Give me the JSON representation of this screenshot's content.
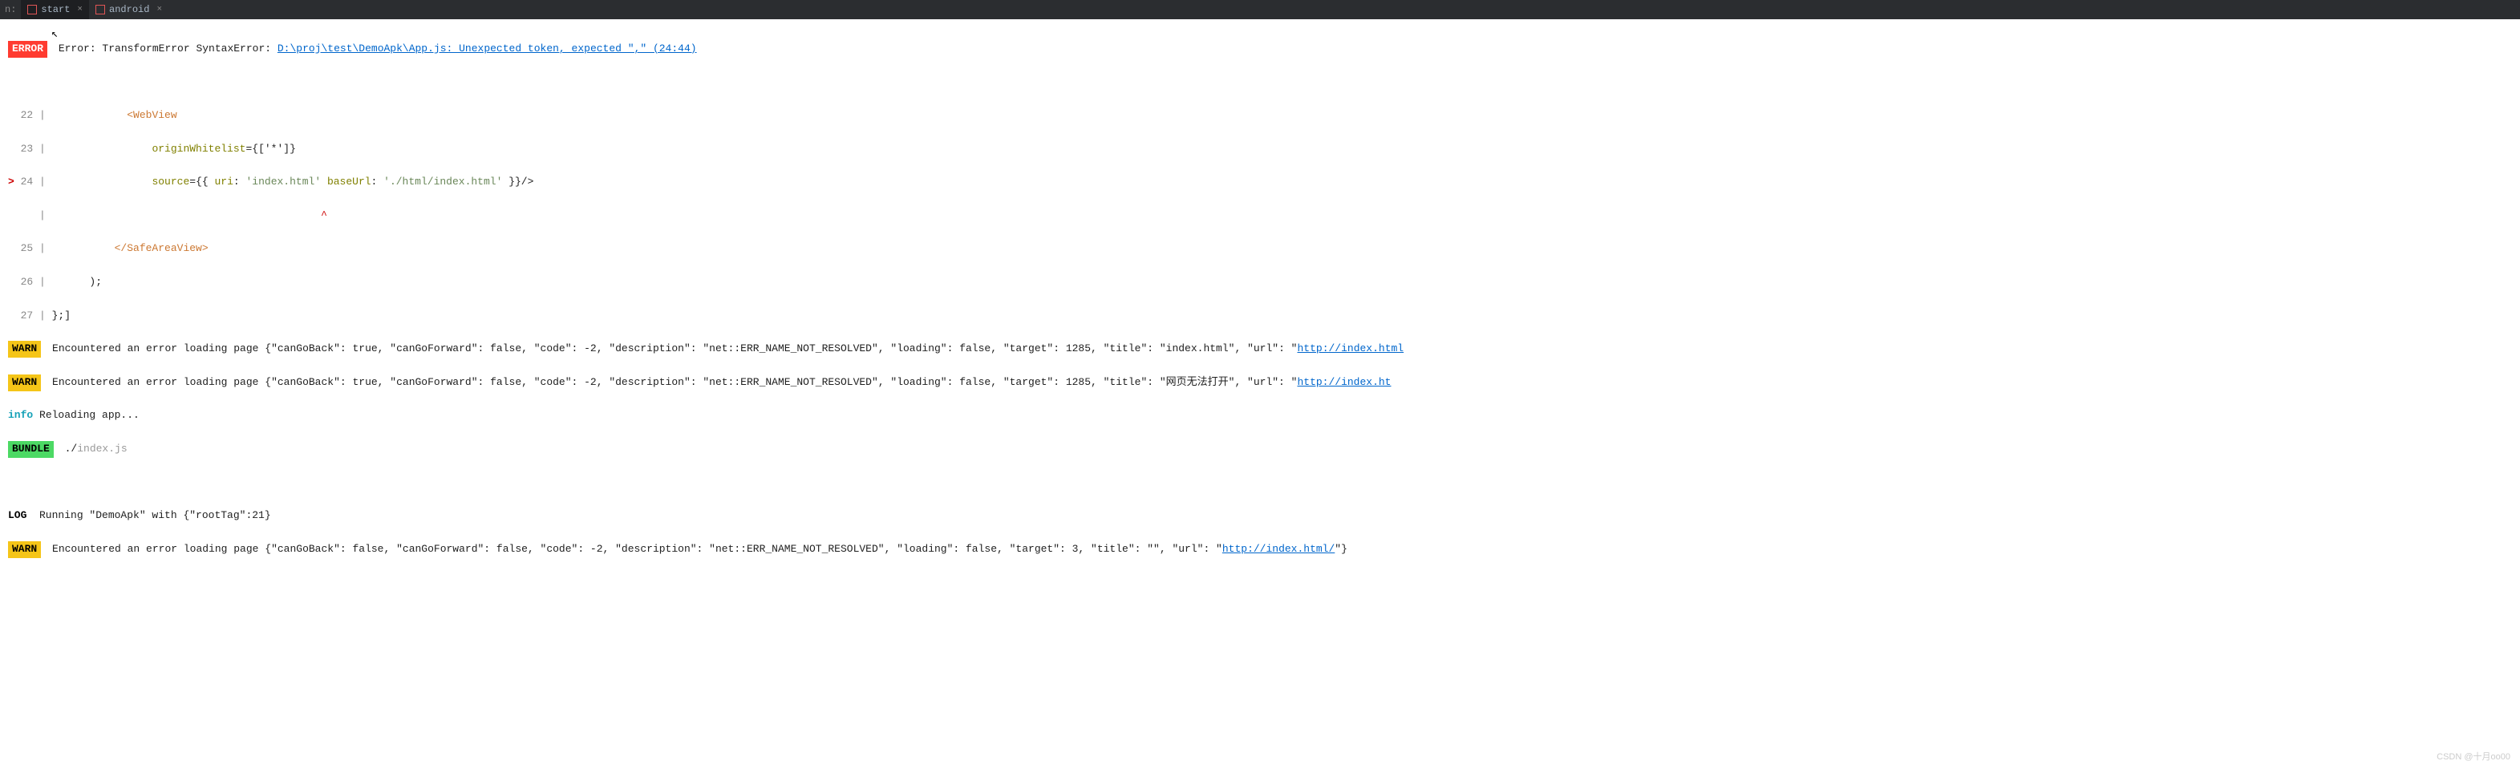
{
  "tabBar": {
    "prefix": "n:",
    "tabs": [
      {
        "label": "start",
        "active": true
      },
      {
        "label": "android",
        "active": false
      }
    ],
    "closeGlyph": "×"
  },
  "badges": {
    "error": "ERROR",
    "warn": "WARN",
    "info": "info",
    "bundle": "BUNDLE",
    "log": "LOG"
  },
  "errorLine": {
    "prefix": " Error: TransformError SyntaxError: ",
    "link": "D:\\proj\\test\\DemoApk\\App.js: Unexpected token, expected \",\" (24:44)"
  },
  "codeLines": {
    "l22_num": "  22 | ",
    "l22_indent": "            ",
    "l22_tag": "<WebView",
    "l23_num": "  23 | ",
    "l23_indent": "                ",
    "l23_attr": "originWhitelist",
    "l23_rest": "={['*']}",
    "l24_marker": "> ",
    "l24_num": "24 | ",
    "l24_indent": "                ",
    "l24_attr1": "source",
    "l24_eq1": "={{ ",
    "l24_key1": "uri",
    "l24_col1": ": ",
    "l24_str1": "'index.html'",
    "l24_sp": " ",
    "l24_key2": "baseUrl",
    "l24_col2": ": ",
    "l24_str2": "'./html/index.html'",
    "l24_close": " }}/>",
    "caret_num": "     | ",
    "caret_indent": "                                           ",
    "caret": "^",
    "l25_num": "  25 | ",
    "l25_indent": "          ",
    "l25_close": "</SafeAreaView>",
    "l26_num": "  26 | ",
    "l26_text": "      );",
    "l27_num": "  27 | ",
    "l27_text": "};]"
  },
  "warn1": {
    "text": " Encountered an error loading page {\"canGoBack\": true, \"canGoForward\": false, \"code\": -2, \"description\": \"net::ERR_NAME_NOT_RESOLVED\", \"loading\": false, \"target\": 1285, \"title\": \"index.html\", \"url\": \"",
    "link": "http://index.html",
    "suffix": ""
  },
  "warn2": {
    "text": " Encountered an error loading page {\"canGoBack\": true, \"canGoForward\": false, \"code\": -2, \"description\": \"net::ERR_NAME_NOT_RESOLVED\", \"loading\": false, \"target\": 1285, \"title\": \"网页无法打开\", \"url\": \"",
    "link": "http://index.ht",
    "suffix": ""
  },
  "infoLine": " Reloading app...",
  "bundleLine": {
    "prefix": " ./",
    "dim": "index.js"
  },
  "logLine": "  Running \"DemoApk\" with {\"rootTag\":21}",
  "warn3": {
    "text": " Encountered an error loading page {\"canGoBack\": false, \"canGoForward\": false, \"code\": -2, \"description\": \"net::ERR_NAME_NOT_RESOLVED\", \"loading\": false, \"target\": 3, \"title\": \"\", \"url\": \"",
    "link": "http://index.html/",
    "suffix": "\"}"
  },
  "watermark": "CSDN @十月oo00"
}
